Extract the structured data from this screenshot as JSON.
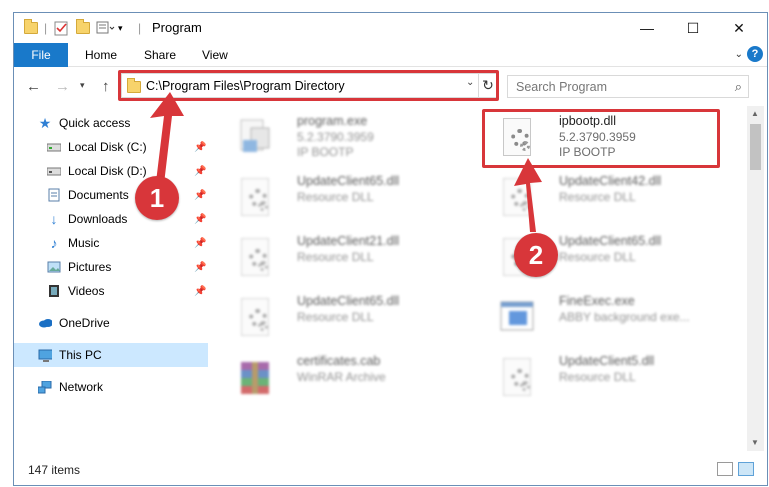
{
  "window": {
    "title": "Program",
    "controls": {
      "minimize": "—",
      "maximize": "☐",
      "close": "✕"
    }
  },
  "ribbon": {
    "tabs": [
      "File",
      "Home",
      "Share",
      "View"
    ],
    "expand_icon": "chevron-down-icon",
    "help_icon": "?"
  },
  "navigation": {
    "back_icon": "back-arrow-icon",
    "forward_icon": "forward-arrow-icon",
    "recent_icon": "chevron-down-icon",
    "up_icon": "up-arrow-icon",
    "address": "C:\\Program Files\\Program Directory",
    "search_placeholder": "Search Program"
  },
  "sidebar": {
    "items": [
      {
        "label": "Quick access",
        "icon": "star-icon",
        "pinned": false
      },
      {
        "label": "Local Disk (C:)",
        "icon": "drive-icon",
        "pinned": true
      },
      {
        "label": "Local Disk (D:)",
        "icon": "drive-icon",
        "pinned": true
      },
      {
        "label": "Documents",
        "icon": "documents-icon",
        "pinned": true
      },
      {
        "label": "Downloads",
        "icon": "download-icon",
        "pinned": true
      },
      {
        "label": "Music",
        "icon": "music-icon",
        "pinned": true
      },
      {
        "label": "Pictures",
        "icon": "pictures-icon",
        "pinned": true
      },
      {
        "label": "Videos",
        "icon": "videos-icon",
        "pinned": true
      },
      {
        "label": "OneDrive",
        "icon": "cloud-icon",
        "pinned": false
      },
      {
        "label": "This PC",
        "icon": "computer-icon",
        "pinned": false,
        "selected": true
      },
      {
        "label": "Network",
        "icon": "network-icon",
        "pinned": false
      }
    ]
  },
  "files": [
    {
      "name": "program.exe",
      "line1": "5.2.3790.3959",
      "line2": "IP BOOTP",
      "blurred": true,
      "icon": "exe-icon"
    },
    {
      "name": "ipbootp.dll",
      "line1": "5.2.3790.3959",
      "line2": "IP BOOTP",
      "blurred": false,
      "icon": "dll-gear-icon"
    },
    {
      "name": "UpdateClient65.dll",
      "line1": "Resource DLL",
      "line2": "",
      "blurred": true,
      "icon": "dll-gear-icon"
    },
    {
      "name": "UpdateClient42.dll",
      "line1": "Resource DLL",
      "line2": "",
      "blurred": true,
      "icon": "dll-gear-icon"
    },
    {
      "name": "UpdateClient21.dll",
      "line1": "Resource DLL",
      "line2": "",
      "blurred": true,
      "icon": "dll-gear-icon"
    },
    {
      "name": "UpdateClient65.dll",
      "line1": "Resource DLL",
      "line2": "",
      "blurred": true,
      "icon": "dll-gear-icon"
    },
    {
      "name": "UpdateClient65.dll",
      "line1": "Resource DLL",
      "line2": "",
      "blurred": true,
      "icon": "dll-gear-icon"
    },
    {
      "name": "FineExec.exe",
      "line1": "ABBY background exe...",
      "line2": "",
      "blurred": true,
      "icon": "exe-window-icon"
    },
    {
      "name": "certificates.cab",
      "line1": "WinRAR Archive",
      "line2": "",
      "blurred": true,
      "icon": "winrar-icon"
    },
    {
      "name": "UpdateClient5.dll",
      "line1": "Resource DLL",
      "line2": "",
      "blurred": true,
      "icon": "dll-gear-icon"
    }
  ],
  "status": {
    "item_count": "147 items"
  },
  "annotations": {
    "step1": "1",
    "step2": "2",
    "color": "#d8363a"
  },
  "colors": {
    "accent": "#1979ca",
    "selection": "#cce8ff",
    "highlight": "#d8363a"
  }
}
